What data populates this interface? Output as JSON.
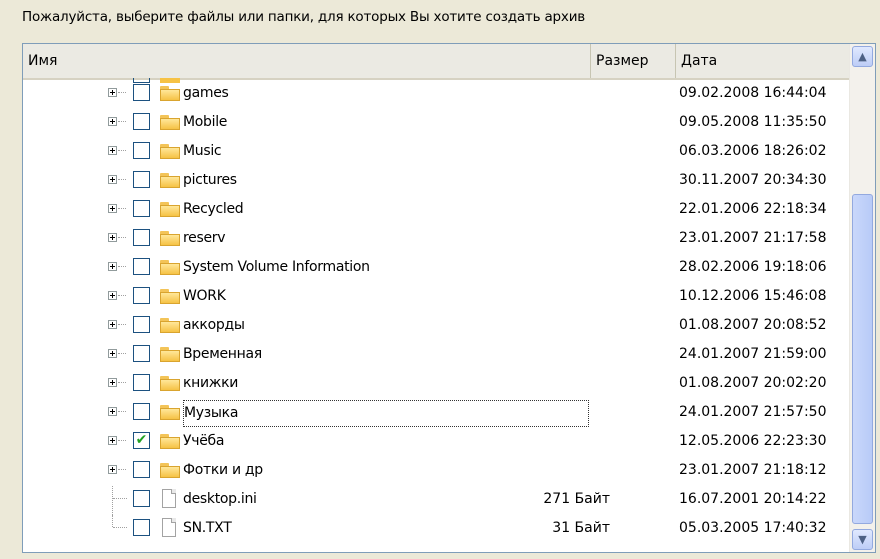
{
  "prompt": "Пожалуйста, выберите файлы или папки, для которых Вы хотите создать архив",
  "columns": {
    "name": "Имя",
    "size": "Размер",
    "date": "Дата"
  },
  "rows": [
    {
      "type": "folder",
      "name": "games",
      "size": "",
      "date": "09.02.2008 16:44:04",
      "checked": false
    },
    {
      "type": "folder",
      "name": "Mobile",
      "size": "",
      "date": "09.05.2008 11:35:50",
      "checked": false
    },
    {
      "type": "folder",
      "name": "Music",
      "size": "",
      "date": "06.03.2006 18:26:02",
      "checked": false
    },
    {
      "type": "folder",
      "name": "pictures",
      "size": "",
      "date": "30.11.2007 20:34:30",
      "checked": false
    },
    {
      "type": "folder",
      "name": "Recycled",
      "size": "",
      "date": "22.01.2006 22:18:34",
      "checked": false
    },
    {
      "type": "folder",
      "name": "reserv",
      "size": "",
      "date": "23.01.2007 21:17:58",
      "checked": false
    },
    {
      "type": "folder",
      "name": "System Volume Information",
      "size": "",
      "date": "28.02.2006 19:18:06",
      "checked": false
    },
    {
      "type": "folder",
      "name": "WORK",
      "size": "",
      "date": "10.12.2006 15:46:08",
      "checked": false
    },
    {
      "type": "folder",
      "name": "аккорды",
      "size": "",
      "date": "01.08.2007 20:08:52",
      "checked": false
    },
    {
      "type": "folder",
      "name": "Временная",
      "size": "",
      "date": "24.01.2007 21:59:00",
      "checked": false
    },
    {
      "type": "folder",
      "name": "книжки",
      "size": "",
      "date": "01.08.2007 20:02:20",
      "checked": false
    },
    {
      "type": "folder",
      "name": "Музыка",
      "size": "",
      "date": "24.01.2007 21:57:50",
      "checked": false,
      "focused": true
    },
    {
      "type": "folder",
      "name": "Учёба",
      "size": "",
      "date": "12.05.2006 22:23:30",
      "checked": true
    },
    {
      "type": "folder",
      "name": "Фотки и др",
      "size": "",
      "date": "23.01.2007 21:18:12",
      "checked": false
    },
    {
      "type": "file",
      "name": "desktop.ini",
      "size": "271 Байт",
      "date": "16.07.2001 20:14:22",
      "checked": false
    },
    {
      "type": "file",
      "name": "SN.TXT",
      "size": "31 Байт",
      "date": "05.03.2005 17:40:32",
      "checked": false
    }
  ],
  "scrollbar": {
    "up_icon": "arrow-up-icon",
    "down_icon": "arrow-down-icon",
    "position": 0.75
  },
  "colors": {
    "check": "#21A121",
    "folder": "#F6C245",
    "border": "#7F9DB9"
  }
}
